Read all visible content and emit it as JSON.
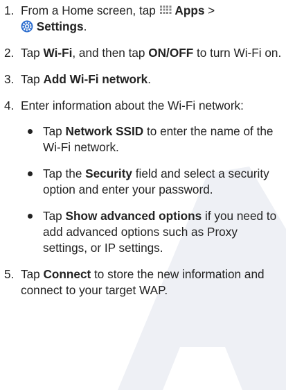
{
  "watermark_color": "#eef0f5",
  "steps": [
    {
      "number": "1.",
      "t1": "From a Home screen, tap ",
      "b1": "Apps",
      "t2": " >",
      "b2": "Settings",
      "t3": ".",
      "icons": [
        "apps-grid-icon",
        "settings-gear-icon"
      ]
    },
    {
      "number": "2.",
      "t1": "Tap ",
      "b1": "Wi-Fi",
      "t2": ", and then tap ",
      "b2": "ON/OFF",
      "t3": " to turn Wi-Fi on."
    },
    {
      "number": "3.",
      "t1": "Tap ",
      "b1": "Add Wi-Fi network",
      "t2": "."
    },
    {
      "number": "4.",
      "text": "Enter information about the Wi-Fi network:",
      "bullets": [
        {
          "t1": "Tap ",
          "b1": "Network SSID",
          "t2": " to enter the name of the Wi-Fi network."
        },
        {
          "t1": "Tap the ",
          "b1": "Security",
          "t2": " field and select a security option and enter your password."
        },
        {
          "t1": "Tap ",
          "b1": "Show advanced options",
          "t2": " if you need to add advanced options such as Proxy settings, or IP settings."
        }
      ]
    },
    {
      "number": "5.",
      "t1": "Tap ",
      "b1": "Connect",
      "t2": " to store the new information and connect to your target WAP."
    }
  ]
}
